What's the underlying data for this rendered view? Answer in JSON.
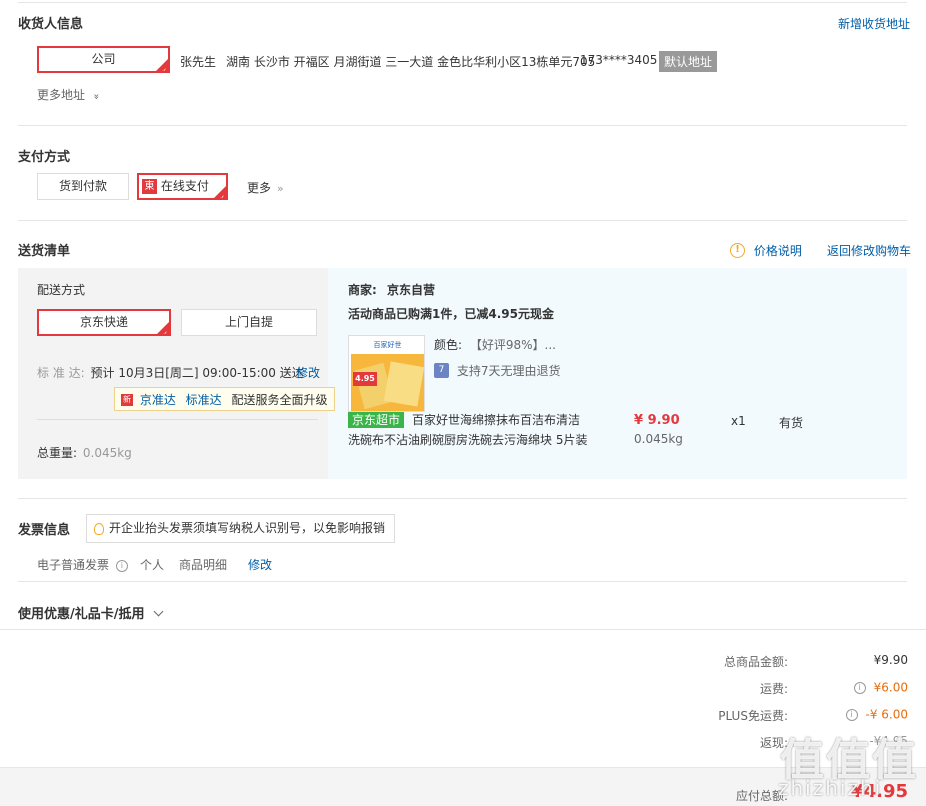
{
  "consignee": {
    "title": "收货人信息",
    "add_link": "新增收货地址",
    "selected_tag": "公司",
    "name": "张先生",
    "address": "湖南 长沙市 开福区 月湖街道 三一大道 金色比华利小区13栋单元705",
    "phone": "173****3405",
    "default_badge": "默认地址",
    "more": "更多地址",
    "more_arrow": "»"
  },
  "payment": {
    "title": "支付方式",
    "cod": "货到付款",
    "online_icon": "東",
    "online": "在线支付",
    "more": "更多",
    "more_arrow": "»"
  },
  "delivery": {
    "title": "送货清单",
    "price_note_icon": "!",
    "price_note": "价格说明",
    "back_cart": "返回修改购物车",
    "method_label": "配送方式",
    "method_selected": "京东快递",
    "method_other": "上门自提",
    "std_label": "标 准 达:",
    "std_value": "预计 10月3日[周二] 09:00-15:00 送达",
    "edit": "修改",
    "tip_icon": "新",
    "tip_brand1": "京准达",
    "tip_brand2": "标准达",
    "tip_text": "配送服务全面升级",
    "weight_label": "总重量:",
    "weight_value": "0.045kg",
    "merchant_label": "商家:",
    "merchant_name": "京东自营",
    "promo": "活动商品已购满1件，已减4.95元现金",
    "product": {
      "image_badge": "4.95",
      "image_top": "百家好世",
      "color_label": "颜色:",
      "color_value": "【好评98%】...",
      "return_icon": "7",
      "return_text": "支持7天无理由退货",
      "tag": "京东超市",
      "name_line1": "百家好世海绵擦抹布百洁布清洁",
      "name_line2": "洗碗布不沾油刷碗厨房洗碗去污海绵块 5片装",
      "price": "¥ 9.90",
      "weight": "0.045kg",
      "qty": "x1",
      "stock": "有货"
    }
  },
  "invoice": {
    "title": "发票信息",
    "tip_icon": "lightbulb-icon",
    "tip": "开企业抬头发票须填写纳税人识别号，以免影响报销",
    "type": "电子普通发票",
    "info_icon": "i",
    "person": "个人",
    "detail": "商品明细",
    "edit": "修改"
  },
  "coupon": {
    "title": "使用优惠/礼品卡/抵用"
  },
  "summary": {
    "total_label": "总商品金额:",
    "total_value": "¥9.90",
    "freight_label": "运费:",
    "freight_value": "¥6.00",
    "plus_label": "PLUS免运费:",
    "plus_value": "-¥ 6.00",
    "rebate_label": "返现:",
    "rebate_value": "-¥4.95",
    "info_icon": "i",
    "payable_label": "应付总额:",
    "payable_value": "¥4.95"
  },
  "watermark": {
    "text": "zhizhizhi",
    "glyph": "值值值"
  }
}
